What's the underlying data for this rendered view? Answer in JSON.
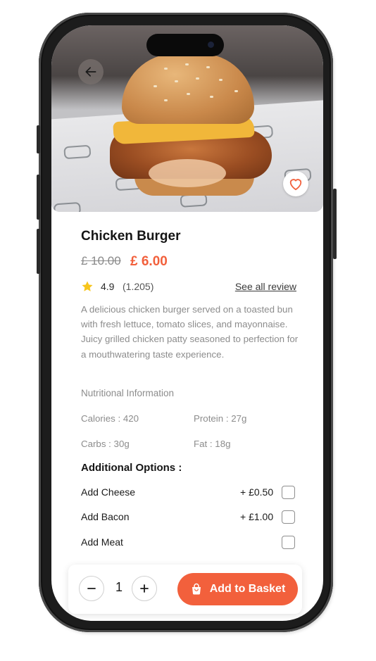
{
  "product": {
    "name": "Chicken Burger",
    "old_price": "£ 10.00",
    "new_price": "£ 6.00",
    "rating": "4.9",
    "review_count": "(1.205)",
    "see_all_label": "See all review",
    "description": "A delicious chicken burger served on a toasted bun with fresh lettuce, tomato slices, and mayonnaise. Juicy grilled chicken patty seasoned to perfection for a mouthwatering taste experience.",
    "favorited": false
  },
  "nutrition": {
    "title": "Nutritional Information",
    "calories": "Calories : 420",
    "protein": "Protein : 27g",
    "carbs": "Carbs : 30g",
    "fat": "Fat : 18g"
  },
  "options": {
    "title": "Additional Options :",
    "items": [
      {
        "label": "Add Cheese",
        "price": "+ £0.50",
        "checked": false
      },
      {
        "label": "Add Bacon",
        "price": "+ £1.00",
        "checked": false
      },
      {
        "label": "Add Meat",
        "price": "",
        "checked": false
      }
    ]
  },
  "cart": {
    "quantity": "1",
    "add_label": "Add to Basket"
  },
  "icons": {
    "back": "arrow-left-icon",
    "favorite": "heart-icon",
    "star": "star-icon",
    "minus": "minus-icon",
    "plus": "plus-icon",
    "basket": "shopping-bag-icon"
  },
  "colors": {
    "accent": "#f2603c",
    "star": "#f7c51b",
    "text": "#151515",
    "muted": "#8c8c8c"
  }
}
